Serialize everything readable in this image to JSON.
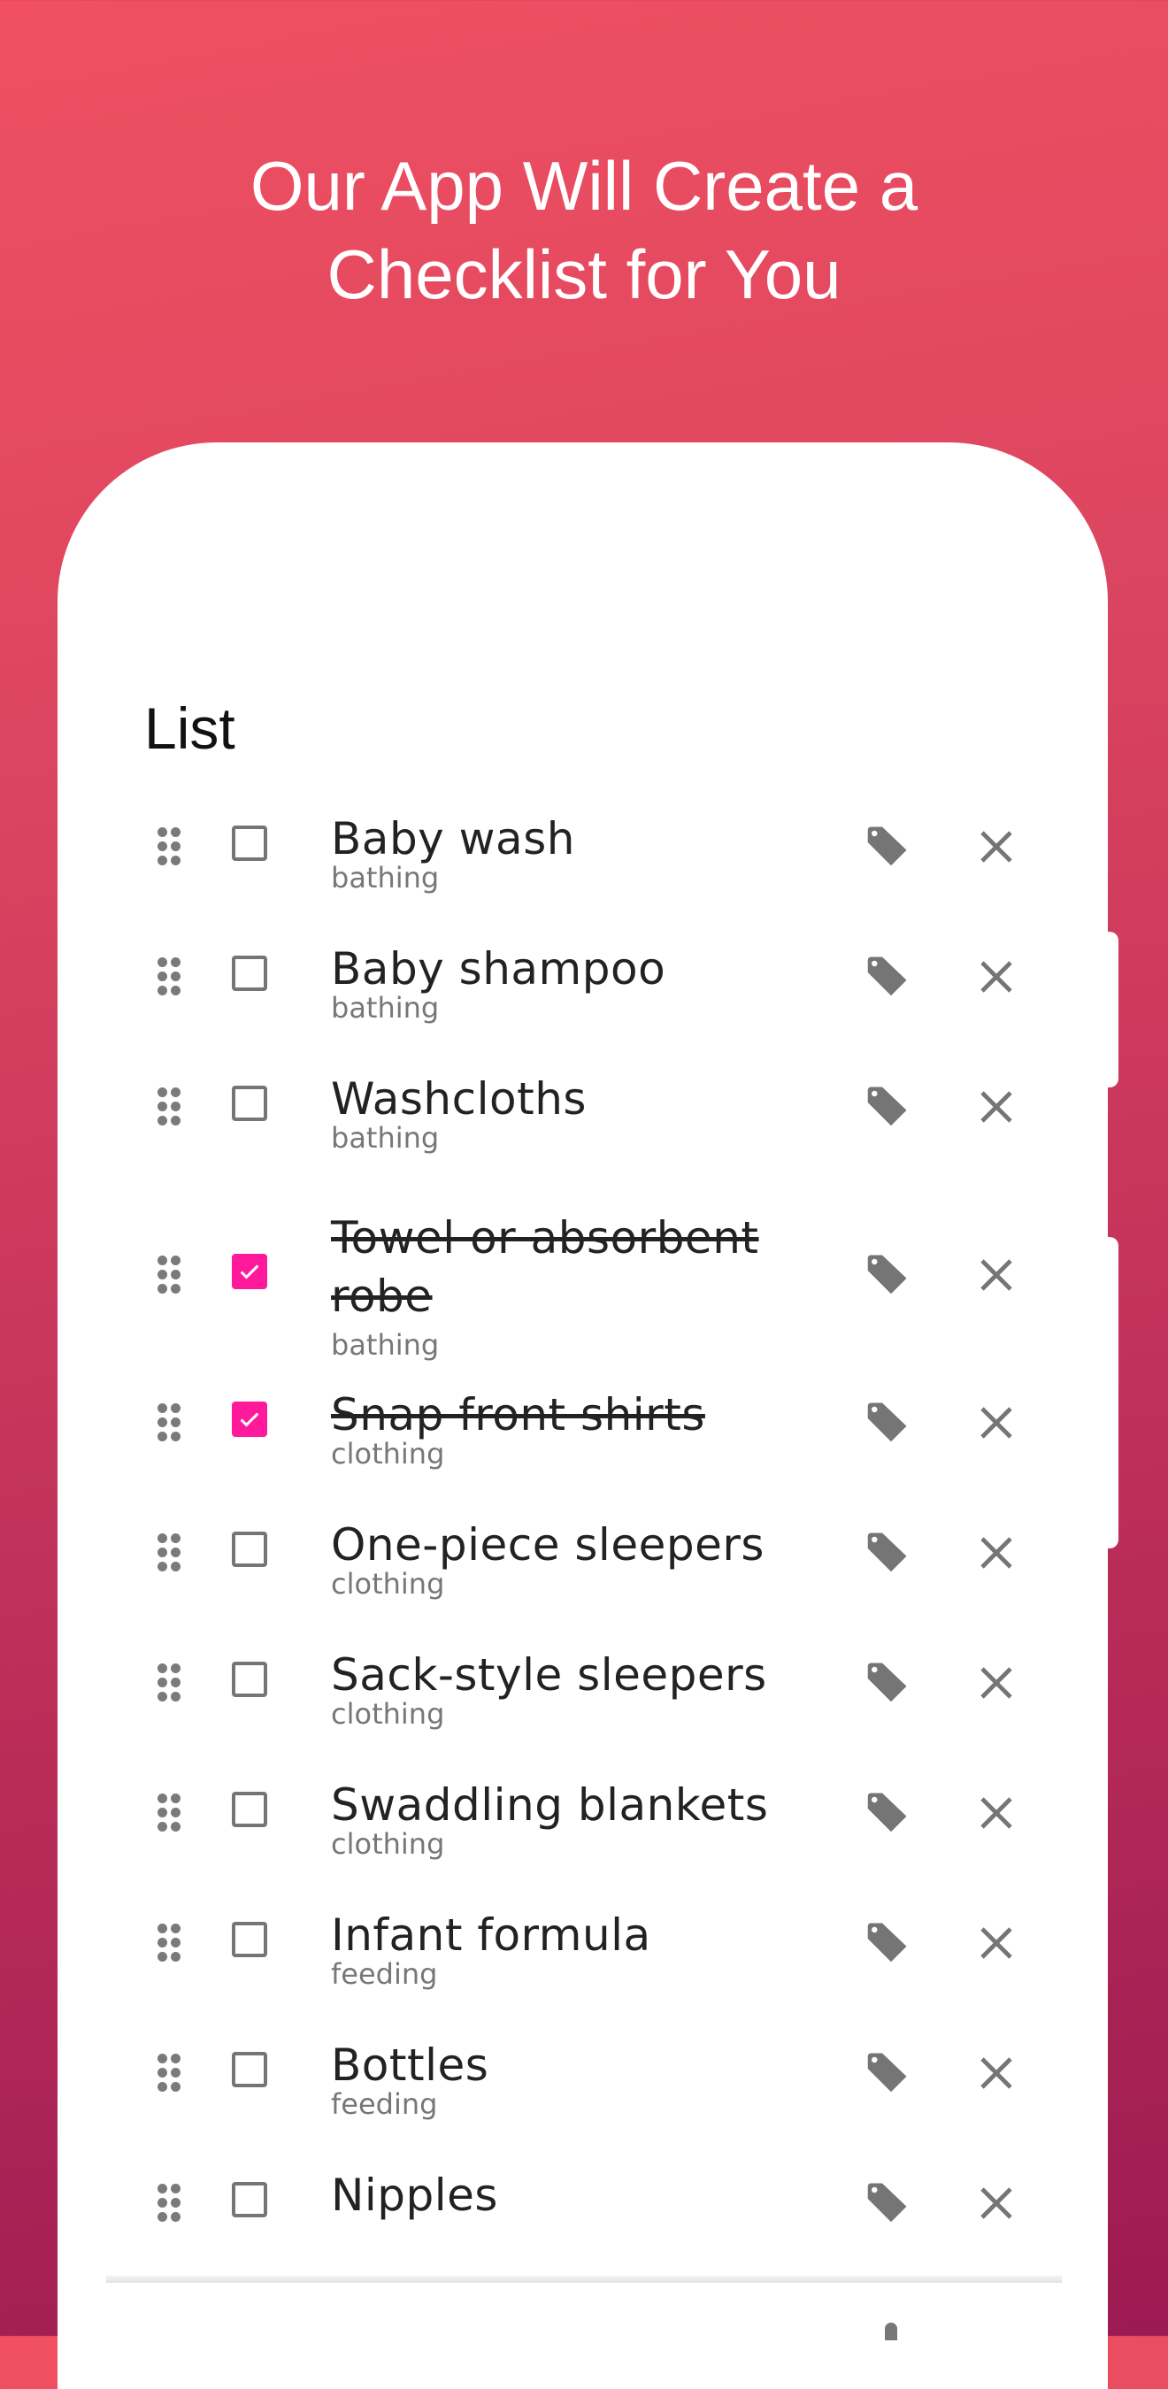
{
  "headline": {
    "line1": "Our App Will Create a",
    "line2": "Checklist for You"
  },
  "colors": {
    "gradient_start": "#f05061",
    "gradient_end": "#9c1a52",
    "checkbox_checked": "#ff1a9c",
    "icon_gray": "#757575"
  },
  "list": {
    "title": "List",
    "items": [
      {
        "name": "Baby wash",
        "category": "bathing",
        "checked": false
      },
      {
        "name": "Baby shampoo",
        "category": "bathing",
        "checked": false
      },
      {
        "name": "Washcloths",
        "category": "bathing",
        "checked": false
      },
      {
        "name": "Towel or absorbent robe",
        "category": "bathing",
        "checked": true
      },
      {
        "name": "Snap front shirts",
        "category": "clothing",
        "checked": true
      },
      {
        "name": "One-piece sleepers",
        "category": "clothing",
        "checked": false
      },
      {
        "name": "Sack-style sleepers",
        "category": "clothing",
        "checked": false
      },
      {
        "name": "Swaddling blankets",
        "category": "clothing",
        "checked": false
      },
      {
        "name": "Infant formula",
        "category": "feeding",
        "checked": false
      },
      {
        "name": "Bottles",
        "category": "feeding",
        "checked": false
      },
      {
        "name": "Nipples",
        "category": "",
        "checked": false
      }
    ],
    "icons": {
      "drag": "drag-handle-icon",
      "tag": "tag-icon",
      "remove": "close-icon"
    }
  }
}
